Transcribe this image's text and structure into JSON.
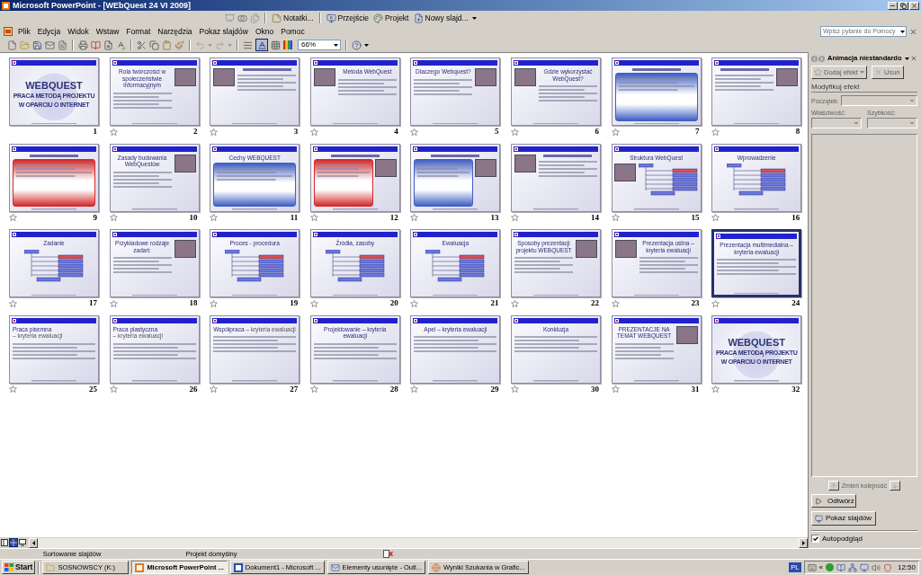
{
  "window": {
    "title": "Microsoft PowerPoint - [WEbQuest 24 VI 2009]"
  },
  "sorter_toolbar": {
    "buttons": [
      "Notatki...",
      "Przejście",
      "Projekt",
      "Nowy slajd..."
    ]
  },
  "menu_bar": {
    "items": [
      "Plik",
      "Edycja",
      "Widok",
      "Wstaw",
      "Format",
      "Narzędzia",
      "Pokaz slajdów",
      "Okno",
      "Pomoc"
    ],
    "help_search": {
      "placeholder": "Wpisz pytanie do Pomocy"
    }
  },
  "standard_toolbar": {
    "show_formatting": {
      "pressed": true
    },
    "zoom": "66%"
  },
  "slides": [
    {
      "number": "1",
      "kind": "cover",
      "title_lines": [
        "WEBQUEST",
        "PRACA METODĄ PROJEKTU",
        "W OPARCIU O INTERNET"
      ],
      "animated": false,
      "selected": false
    },
    {
      "number": "2",
      "kind": "text_photo",
      "title": "Rola twórczości w społeczeństwie informacyjnym",
      "animated": true,
      "selected": false
    },
    {
      "number": "3",
      "kind": "photo_text",
      "animated": true,
      "selected": false
    },
    {
      "number": "4",
      "kind": "photo_text",
      "title": "Metoda WebQuest",
      "animated": true,
      "selected": false
    },
    {
      "number": "5",
      "kind": "text_photo",
      "title": "Dlaczego Webquest?",
      "animated": true,
      "selected": false
    },
    {
      "number": "6",
      "kind": "photo_text",
      "title": "Gdzie wykorzystać WebQuest?",
      "animated": true,
      "selected": false
    },
    {
      "number": "7",
      "kind": "panel",
      "color": "#3f5fc4",
      "animated": true,
      "selected": false
    },
    {
      "number": "8",
      "kind": "text_photo",
      "animated": true,
      "selected": false
    },
    {
      "number": "9",
      "kind": "panel",
      "color": "#d42a2a",
      "animated": true,
      "selected": false
    },
    {
      "number": "10",
      "kind": "text_photo",
      "title": "Zasady budowania WebQuestów",
      "animated": true,
      "selected": false
    },
    {
      "number": "11",
      "kind": "panel",
      "title": "Cechy WEBQUEST",
      "color": "#3f5fc4",
      "animated": true,
      "selected": false
    },
    {
      "number": "12",
      "kind": "panel_photo",
      "color": "#d42a2a",
      "animated": true,
      "selected": false
    },
    {
      "number": "13",
      "kind": "panel_photo",
      "color": "#3f5fc4",
      "animated": true,
      "selected": false
    },
    {
      "number": "14",
      "kind": "photo_text",
      "animated": true,
      "selected": false
    },
    {
      "number": "15",
      "kind": "photo_diagram",
      "title": "Struktura WebQuest",
      "animated": true,
      "selected": false
    },
    {
      "number": "16",
      "kind": "diagram",
      "title": "Wprowadzenie",
      "animated": true,
      "selected": false
    },
    {
      "number": "17",
      "kind": "diagram",
      "title": "Zadanie",
      "animated": true,
      "selected": false
    },
    {
      "number": "18",
      "kind": "text_photo",
      "title": "Przykładowe rodzaje zadań:",
      "animated": true,
      "selected": false
    },
    {
      "number": "19",
      "kind": "diagram",
      "title": "Proces - procedura",
      "animated": true,
      "selected": false
    },
    {
      "number": "20",
      "kind": "diagram",
      "title": "Źródła, zasoby",
      "animated": true,
      "selected": false
    },
    {
      "number": "21",
      "kind": "diagram",
      "title": "Ewaluacja",
      "animated": true,
      "selected": false
    },
    {
      "number": "22",
      "kind": "text_photo",
      "title": "Sposoby prezentacji projektu WEBQUEST",
      "animated": true,
      "selected": false
    },
    {
      "number": "23",
      "kind": "photo_text",
      "title": "Prezentacja ustna – kryteria ewaluacji",
      "animated": true,
      "selected": false
    },
    {
      "number": "24",
      "kind": "text",
      "title": "Prezentacja multimedialna – kryteria ewaluacji",
      "animated": true,
      "selected": true
    },
    {
      "number": "25",
      "kind": "text",
      "title": "Praca pisemna",
      "subtitle": "– kryteria ewaluacji",
      "animated": true,
      "selected": false
    },
    {
      "number": "26",
      "kind": "text",
      "title": "Praca plastyczna",
      "subtitle": "– kryteria ewaluacji",
      "animated": true,
      "selected": false
    },
    {
      "number": "27",
      "kind": "text",
      "title": "Współpraca",
      "subtitle": "– kryteria ewaluacji",
      "animated": true,
      "selected": false
    },
    {
      "number": "28",
      "kind": "text",
      "title": "Projektowanie – kryteria ewaluacji",
      "animated": true,
      "selected": false
    },
    {
      "number": "29",
      "kind": "text",
      "title": "Apel – kryteria ewaluacji",
      "animated": true,
      "selected": false
    },
    {
      "number": "30",
      "kind": "text",
      "title": "Konkluzja",
      "animated": true,
      "selected": false
    },
    {
      "number": "31",
      "kind": "text_photo",
      "title": "PREZENTACJE NA TEMAT WEBQUEST",
      "animated": true,
      "selected": false
    },
    {
      "number": "32",
      "kind": "cover",
      "title_lines": [
        "WEBQUEST",
        "PRACA METODĄ PROJEKTU",
        "W OPARCIU O INTERNET"
      ],
      "animated": true,
      "selected": false
    }
  ],
  "view_buttons": [
    {
      "kind": "normal",
      "selected": false
    },
    {
      "kind": "sorter",
      "selected": true
    },
    {
      "kind": "show",
      "selected": false
    }
  ],
  "task_pane": {
    "title": "Animacja niestandardo",
    "add_effect": {
      "label": "Dodaj efekt",
      "disabled": true
    },
    "remove": {
      "label": "Usuń",
      "disabled": true
    },
    "section": "Modyfikuj efekt",
    "fields": [
      {
        "label": "Początek:",
        "disabled": true
      },
      {
        "label": "Właściwość:",
        "disabled": true
      },
      {
        "label": "Szybkość:",
        "disabled": true
      }
    ],
    "effects_list": {
      "disabled": true
    },
    "reorder": {
      "label": "Zmień kolejność",
      "disabled": true
    },
    "play": {
      "label": "Odtwórz"
    },
    "slide_show": {
      "label": "Pokaz slajdów"
    },
    "autopreview": {
      "label": "Autopodgląd",
      "checked": true
    }
  },
  "status_bar": {
    "view": "Sortowanie slajdów",
    "design": "Projekt domyślny"
  },
  "taskbar": {
    "start": "Start",
    "buttons": [
      {
        "label": "SOSNOWSCY (K:)",
        "selected": false
      },
      {
        "label": "Microsoft PowerPoint ...",
        "selected": true
      },
      {
        "label": "Dokument1 - Microsoft ...",
        "selected": false
      },
      {
        "label": "Elementy usunięte - Outl...",
        "selected": false
      },
      {
        "label": "Wyniki Szukania w Grafic...",
        "selected": false
      }
    ],
    "tray": {
      "language": "PL",
      "expand": "«",
      "clock": "12:50"
    }
  }
}
